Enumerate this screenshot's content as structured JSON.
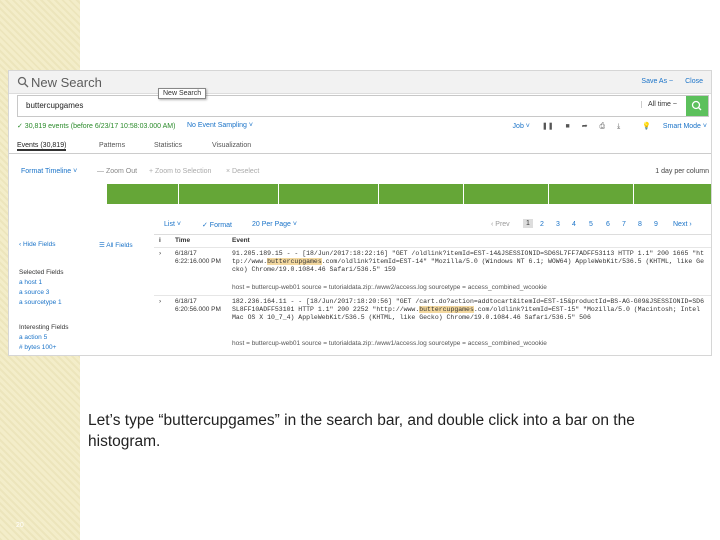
{
  "header": {
    "title": "New Search",
    "save_as": "Save As ~",
    "close": "Close"
  },
  "search": {
    "query": "buttercupgames",
    "time_range": "All time ~",
    "tooltip": "New Search"
  },
  "status": {
    "events": "✓ 30,819 events (before 6/23/17 10:58:03.000 AM)",
    "sampling": "No Event Sampling ˅",
    "job": "Job ˅",
    "mode": "Smart Mode ˅"
  },
  "tabs": [
    "Events (30,819)",
    "Patterns",
    "Statistics",
    "Visualization"
  ],
  "timeline": {
    "format": "Format Timeline ˅",
    "zoom_out": "— Zoom Out",
    "zoom_sel": "+ Zoom to Selection",
    "deselect": "× Deselect",
    "scale": "1 day per column"
  },
  "pager": {
    "list": "List ˅",
    "format": "✓ Format",
    "per_page": "20 Per Page ˅",
    "prev": "‹ Prev",
    "pages": [
      "1",
      "2",
      "3",
      "4",
      "5",
      "6",
      "7",
      "8",
      "9"
    ],
    "next": "Next ›"
  },
  "sidebar": {
    "hide": "‹ Hide Fields",
    "all": "☰ All Fields",
    "selected_title": "Selected Fields",
    "selected": [
      "a host 1",
      "a source 3",
      "a sourcetype 1"
    ],
    "interesting_title": "Interesting Fields",
    "interesting": [
      "a action 5",
      "# bytes 100+"
    ]
  },
  "grid": {
    "col_i": "i",
    "col_time": "Time",
    "col_event": "Event",
    "events": [
      {
        "date": "6/18/17",
        "time": "6:22:16.000 PM",
        "pre": "91.205.189.15 - - [18/Jun/2017:18:22:16] \"GET /oldlink?itemId=EST-14&JSESSIONID=SD6SL7FF7ADFF53113 HTTP 1.1\" 200 1665 \"http://www.",
        "hl": "buttercupgames",
        "post": ".com/oldlink?itemId=EST-14\" \"Mozilla/5.0 (Windows NT 6.1; WOW64) AppleWebKit/536.5 (KHTML, like Gecko) Chrome/19.0.1084.46 Safari/536.5\" 159",
        "meta": "host = buttercup-web01     source = tutorialdata.zip:./www2/access.log     sourcetype = access_combined_wcookie"
      },
      {
        "date": "6/18/17",
        "time": "6:20:56.000 PM",
        "pre": "182.236.164.11 - - [18/Jun/2017:18:20:56] \"GET /cart.do?action=addtocart&itemId=EST-15&productId=BS-AG-G09&JSESSIONID=SD6SL8FF10ADFF53101 HTTP 1.1\" 200 2252 \"http://www.",
        "hl": "buttercupgames",
        "post": ".com/oldlink?itemId=EST-15\" \"Mozilla/5.0 (Macintosh; Intel Mac OS X 10_7_4) AppleWebKit/536.5 (KHTML, like Gecko) Chrome/19.0.1084.46 Safari/536.5\" 506",
        "meta": "host = buttercup-web01     source = tutorialdata.zip:./www1/access.log     sourcetype = access_combined_wcookie"
      }
    ]
  },
  "caption": "Let’s type “buttercupgames” in the search bar, and double click into a bar on the histogram.",
  "page_number": "20",
  "colors": {
    "accent": "#65a637",
    "link": "#1a73c8",
    "sidebar_bg": "#f3edc9"
  }
}
